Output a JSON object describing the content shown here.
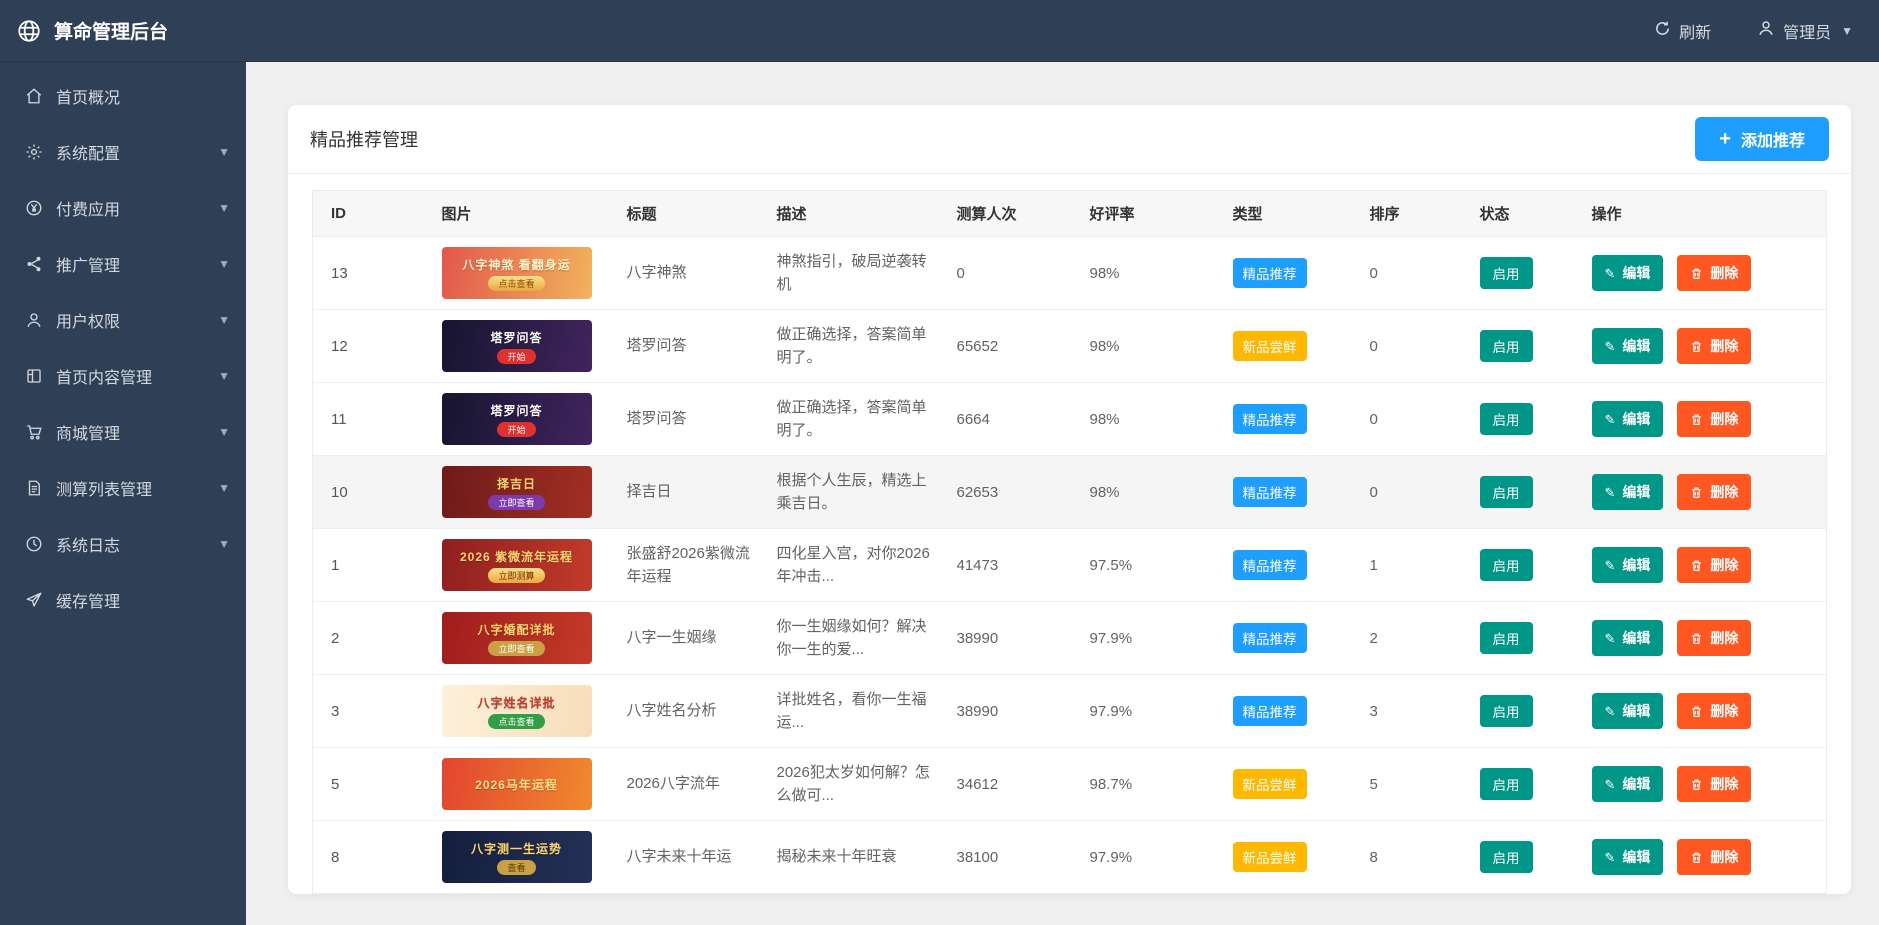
{
  "app": {
    "title": "算命管理后台",
    "logo_icon": "globe-icon"
  },
  "header": {
    "refresh_label": "刷新",
    "user_label": "管理员"
  },
  "sidebar": {
    "items": [
      {
        "label": "首页概况",
        "icon": "home-icon",
        "expandable": false
      },
      {
        "label": "系统配置",
        "icon": "gear-icon",
        "expandable": true
      },
      {
        "label": "付费应用",
        "icon": "yen-icon",
        "expandable": true
      },
      {
        "label": "推广管理",
        "icon": "share-icon",
        "expandable": true
      },
      {
        "label": "用户权限",
        "icon": "user-icon",
        "expandable": true
      },
      {
        "label": "首页内容管理",
        "icon": "layout-icon",
        "expandable": true
      },
      {
        "label": "商城管理",
        "icon": "cart-icon",
        "expandable": true
      },
      {
        "label": "测算列表管理",
        "icon": "document-icon",
        "expandable": true
      },
      {
        "label": "系统日志",
        "icon": "clock-icon",
        "expandable": true
      },
      {
        "label": "缓存管理",
        "icon": "send-icon",
        "expandable": false
      }
    ]
  },
  "page": {
    "card_title": "精品推荐管理",
    "add_button_label": "添加推荐",
    "table": {
      "columns": [
        "ID",
        "图片",
        "标题",
        "描述",
        "测算人次",
        "好评率",
        "类型",
        "排序",
        "状态",
        "操作"
      ],
      "status_enabled": "启用",
      "action_edit": "编辑",
      "action_delete": "删除",
      "rows": [
        {
          "id": "13",
          "title": "八字神煞",
          "desc": "神煞指引，破局逆袭转机",
          "count": "0",
          "rate": "98%",
          "type": "精品推荐",
          "type_color": "#1E9FFF",
          "order": "0",
          "highlight": false,
          "image": {
            "text": "八字神煞 看翻身运",
            "bg": "linear-gradient(100deg,#e2574c,#f2b35c)",
            "fg": "#fff3c8",
            "btn": "点击查看",
            "btn_bg": "linear-gradient(#fbe08a,#e9a83e)",
            "btn_fg": "#8a4a00"
          }
        },
        {
          "id": "12",
          "title": "塔罗问答",
          "desc": "做正确选择，答案简单明了。",
          "count": "65652",
          "rate": "98%",
          "type": "新品尝鲜",
          "type_color": "#FFB800",
          "order": "0",
          "highlight": false,
          "image": {
            "text": "塔罗问答",
            "bg": "linear-gradient(100deg,#15152e,#41245e)",
            "fg": "#ffffff",
            "btn": "开始",
            "btn_bg": "#e03131",
            "btn_fg": "#ffffff"
          }
        },
        {
          "id": "11",
          "title": "塔罗问答",
          "desc": "做正确选择，答案简单明了。",
          "count": "6664",
          "rate": "98%",
          "type": "精品推荐",
          "type_color": "#1E9FFF",
          "order": "0",
          "highlight": false,
          "image": {
            "text": "塔罗问答",
            "bg": "linear-gradient(100deg,#15152e,#41245e)",
            "fg": "#ffffff",
            "btn": "开始",
            "btn_bg": "#e03131",
            "btn_fg": "#ffffff"
          }
        },
        {
          "id": "10",
          "title": "择吉日",
          "desc": "根据个人生辰，精选上乘吉日。",
          "count": "62653",
          "rate": "98%",
          "type": "精品推荐",
          "type_color": "#1E9FFF",
          "order": "0",
          "highlight": true,
          "image": {
            "text": "择吉日",
            "bg": "linear-gradient(100deg,#6d1a1a,#a22f23)",
            "fg": "#ffd76e",
            "btn": "立即查看",
            "btn_bg": "#7c3aad",
            "btn_fg": "#ffffff"
          }
        },
        {
          "id": "1",
          "title": "张盛舒2026紫微流年运程",
          "desc": "四化星入宫，对你2026年冲击...",
          "count": "41473",
          "rate": "97.5%",
          "type": "精品推荐",
          "type_color": "#1E9FFF",
          "order": "1",
          "highlight": false,
          "image": {
            "text": "2026 紫微流年运程",
            "bg": "linear-gradient(100deg,#8e1f1f,#c23b2a)",
            "fg": "#ffd76e",
            "btn": "立即测算",
            "btn_bg": "linear-gradient(#fbe08a,#e9a83e)",
            "btn_fg": "#7a2a00"
          }
        },
        {
          "id": "2",
          "title": "八字一生姻缘",
          "desc": "你一生姻缘如何？解决你一生的爱...",
          "count": "38990",
          "rate": "97.9%",
          "type": "精品推荐",
          "type_color": "#1E9FFF",
          "order": "2",
          "highlight": false,
          "image": {
            "text": "八字婚配详批",
            "bg": "linear-gradient(100deg,#a01d1d,#c53a28)",
            "fg": "#ffd76e",
            "btn": "立即查看",
            "btn_bg": "#caa045",
            "btn_fg": "#ffffff"
          }
        },
        {
          "id": "3",
          "title": "八字姓名分析",
          "desc": "详批姓名，看你一生福运...",
          "count": "38990",
          "rate": "97.9%",
          "type": "精品推荐",
          "type_color": "#1E9FFF",
          "order": "3",
          "highlight": false,
          "image": {
            "text": "八字姓名详批",
            "bg": "linear-gradient(100deg,#fdf1da,#f7ddba)",
            "fg": "#c0392b",
            "btn": "点击查看",
            "btn_bg": "#2f9e44",
            "btn_fg": "#ffffff"
          }
        },
        {
          "id": "5",
          "title": "2026八字流年",
          "desc": "2026犯太岁如何解？怎么做可...",
          "count": "34612",
          "rate": "98.7%",
          "type": "新品尝鲜",
          "type_color": "#FFB800",
          "order": "5",
          "highlight": false,
          "image": {
            "text": "2026马年运程",
            "bg": "linear-gradient(100deg,#e2452f,#f08a2e)",
            "fg": "#ffe08a",
            "btn": "",
            "btn_bg": "",
            "btn_fg": ""
          }
        },
        {
          "id": "8",
          "title": "八字未来十年运",
          "desc": "揭秘未来十年旺衰",
          "count": "38100",
          "rate": "97.9%",
          "type": "新品尝鲜",
          "type_color": "#FFB800",
          "order": "8",
          "highlight": false,
          "image": {
            "text": "八字测一生运势",
            "bg": "linear-gradient(100deg,#141e3c,#253057)",
            "fg": "#ffd76e",
            "btn": "查看",
            "btn_bg": "#caa045",
            "btn_fg": "#5a3a00"
          }
        }
      ]
    }
  },
  "colors": {
    "primary_blue": "#1E9FFF",
    "warning_orange": "#FFB800",
    "success_teal": "#009688",
    "danger_red": "#FF5722",
    "sidebar_dark": "#2f4056"
  }
}
